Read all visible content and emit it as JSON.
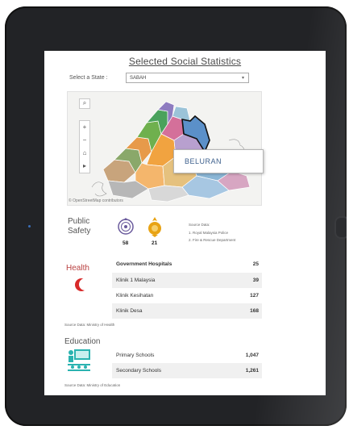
{
  "title": "Selected Social Statistics",
  "state_selector": {
    "label": "Select a State :",
    "value": "SABAH"
  },
  "map": {
    "tooltip": "BELURAN",
    "attribution": "© OpenStreetMap contributors"
  },
  "public_safety": {
    "label": "Public Safety",
    "police_count": "58",
    "fire_count": "21",
    "source_title": "Source Data:",
    "source_1": "1. Royal Malaysia Police",
    "source_2": "2. Fire & Rescue Department"
  },
  "health": {
    "label": "Health",
    "header": {
      "name": "Government Hospitals",
      "value": "25"
    },
    "rows": [
      {
        "name": "Klinik 1 Malaysia",
        "value": "39"
      },
      {
        "name": "Klinik Kesihatan",
        "value": "127"
      },
      {
        "name": "Klinik Desa",
        "value": "168"
      }
    ],
    "source": "Source Data: Ministry of Health"
  },
  "education": {
    "label": "Education",
    "rows": [
      {
        "name": "Primary Schools",
        "value": "1,047"
      },
      {
        "name": "Secondary Schools",
        "value": "1,261"
      }
    ],
    "source": "Source Data: Ministry of Education"
  },
  "colors": {
    "tablet": "#222326",
    "crescent": "#d82a2a",
    "police_badge": "#6a5a9c",
    "fire_badge": "#e8a314",
    "education_icon": "#2ab3b0",
    "tooltip_text": "#3c5f8c"
  }
}
